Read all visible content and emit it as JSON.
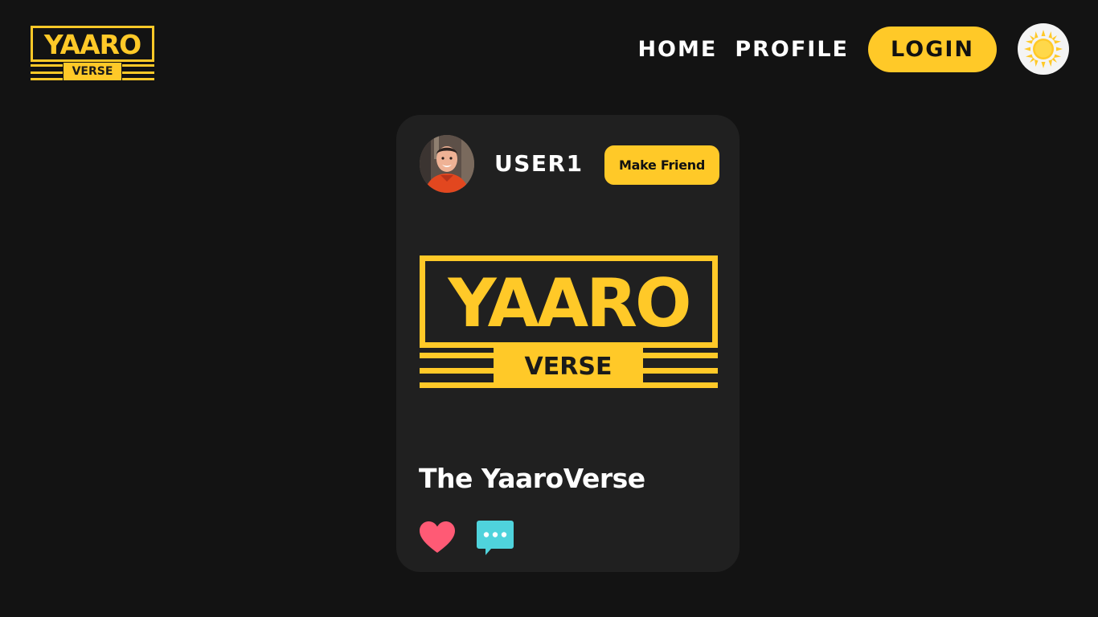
{
  "header": {
    "logo": {
      "main": "YAARO",
      "sub": "VERSE"
    },
    "nav": [
      {
        "label": "HOME"
      },
      {
        "label": "PROFILE"
      }
    ],
    "login_label": "LOGIN",
    "theme_icon": "sun-icon"
  },
  "post": {
    "username": "USER1",
    "make_friend_label": "Make Friend",
    "image_logo": {
      "main": "YAARO",
      "sub": "VERSE"
    },
    "title": "The YaaroVerse",
    "like_icon": "heart-icon",
    "comment_icon": "speech-bubble-icon"
  },
  "colors": {
    "background": "#131313",
    "card": "#202020",
    "accent": "#ffc928",
    "like": "#ff5a75",
    "comment": "#4fd3dc"
  }
}
